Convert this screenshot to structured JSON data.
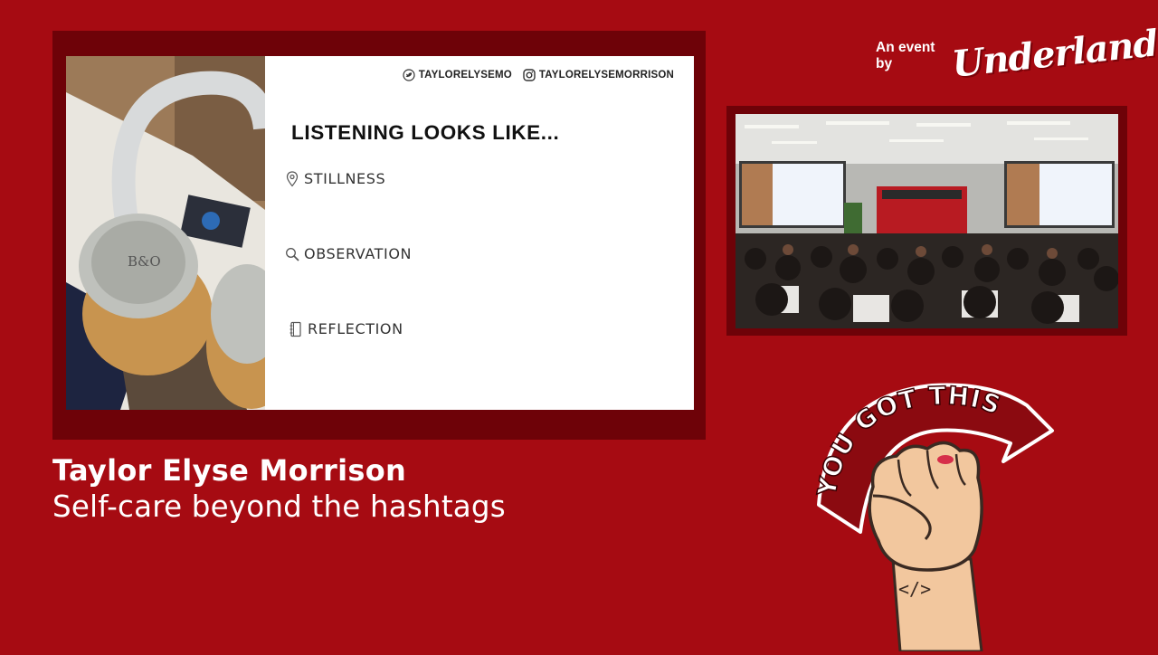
{
  "slide": {
    "socials": [
      {
        "icon": "twitter-icon",
        "handle": "TAYLORELYSEMO"
      },
      {
        "icon": "instagram-icon",
        "handle": "TAYLORELYSEMORRISON"
      }
    ],
    "heading": "LISTENING LOOKS LIKE...",
    "items": [
      {
        "icon": "location-pin-icon",
        "label": "STILLNESS"
      },
      {
        "icon": "magnifier-icon",
        "label": "OBSERVATION"
      },
      {
        "icon": "notebook-icon",
        "label": "REFLECTION"
      }
    ],
    "photo_logo": "B&O"
  },
  "brand": {
    "prefix": "An event by",
    "logo": "Underland"
  },
  "speaker": {
    "name": "Taylor Elyse Morrison",
    "talk_title": "Self-care beyond the hashtags"
  },
  "mascot": {
    "banner_text": "YOU GOT THIS!",
    "wrist_mark": "</>"
  },
  "colors": {
    "background": "#a60b12",
    "frame": "#6e0208",
    "mascot_banner": "#8b0a10"
  }
}
